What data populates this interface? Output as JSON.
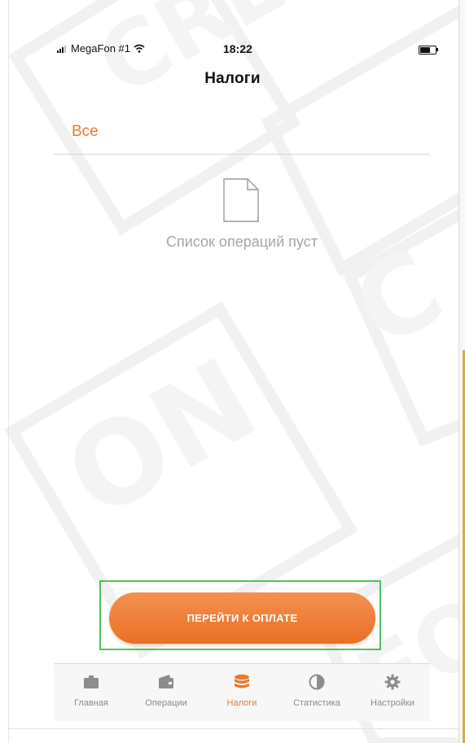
{
  "status_bar": {
    "carrier": "MegaFon #1",
    "time": "18:22"
  },
  "header": {
    "title": "Налоги"
  },
  "filter": {
    "label": "Все"
  },
  "empty_state": {
    "icon": "document-icon",
    "message": "Список операций пуст"
  },
  "actions": {
    "pay_button_label": "ПЕРЕЙТИ К ОПЛАТЕ"
  },
  "tab_bar": {
    "items": [
      {
        "label": "Главная",
        "icon": "briefcase-icon",
        "active": false
      },
      {
        "label": "Операции",
        "icon": "wallet-icon",
        "active": false
      },
      {
        "label": "Налоги",
        "icon": "coins-stack-icon",
        "active": true
      },
      {
        "label": "Статистика",
        "icon": "pie-chart-icon",
        "active": false
      },
      {
        "label": "Настройки",
        "icon": "gear-icon",
        "active": false
      }
    ]
  },
  "colors": {
    "accent": "#ea7a2d",
    "inactive": "#8a8a8a",
    "highlight": "#4fc160"
  }
}
